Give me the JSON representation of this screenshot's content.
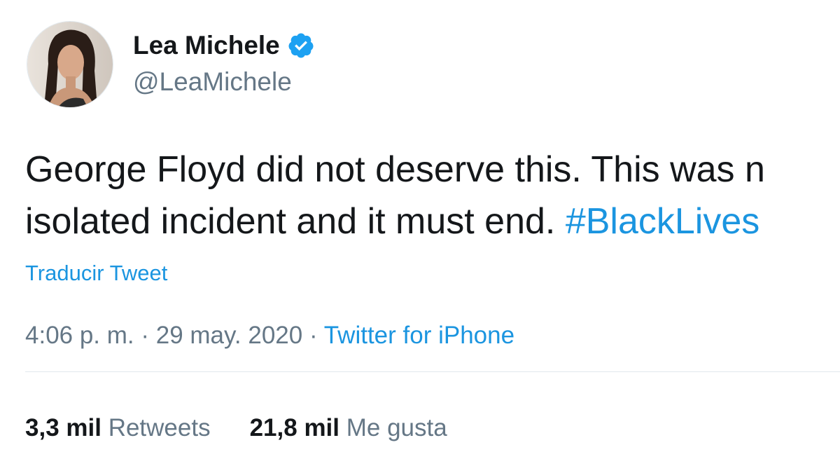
{
  "author": {
    "name": "Lea Michele",
    "handle": "@LeaMichele",
    "verified_icon": "verified-badge-icon",
    "verified_color": "#1da1f2"
  },
  "tweet": {
    "line1": "George Floyd did not deserve this. This was n",
    "line2_text": "isolated incident and it must end. ",
    "line2_hashtag": "#BlackLives"
  },
  "translate_label": "Traducir Tweet",
  "meta": {
    "time": "4:06 p. m.",
    "sep1": " · ",
    "date": "29 may. 2020",
    "sep2": " · ",
    "source": "Twitter for iPhone"
  },
  "stats": {
    "retweets_count": "3,3 mil",
    "retweets_label": "Retweets",
    "likes_count": "21,8 mil",
    "likes_label": "Me gusta"
  },
  "colors": {
    "link": "#1b95e0",
    "secondary_text": "#657786",
    "primary_text": "#14171a",
    "divider": "#e1e8ed"
  }
}
